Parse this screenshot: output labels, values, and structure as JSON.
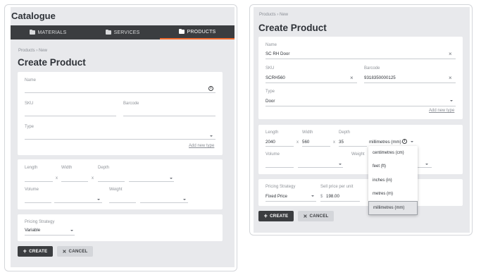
{
  "left": {
    "app_title": "Catalogue",
    "tabs": [
      {
        "label": "MATERIALS",
        "icon": "folder-icon"
      },
      {
        "label": "SERVICES",
        "icon": "folder-icon"
      },
      {
        "label": "PRODUCTS",
        "icon": "folder-icon",
        "active": true
      }
    ],
    "breadcrumb": "Products  ›  New",
    "title": "Create Product",
    "fields": {
      "name_label": "Name",
      "sku_label": "SKU",
      "barcode_label": "Barcode",
      "type_label": "Type",
      "add_type": "Add new type",
      "length_label": "Length",
      "width_label": "Width",
      "depth_label": "Depth",
      "volume_label": "Volume",
      "weight_label": "Weight",
      "pricing_label": "Pricing Strategy",
      "pricing_value": "Variable"
    },
    "buttons": {
      "create": "CREATE",
      "cancel": "CANCEL"
    }
  },
  "right": {
    "breadcrumb": "Products  ›  New",
    "title": "Create Product",
    "fields": {
      "name_label": "Name",
      "name_value": "SC RH Door",
      "sku_label": "SKU",
      "sku_value": "SCRH560",
      "barcode_label": "Barcode",
      "barcode_value": "9318350000125",
      "type_label": "Type",
      "type_value": "Door",
      "add_type": "Add new type",
      "length_label": "Length",
      "length_value": "2040",
      "width_label": "Width",
      "width_value": "560",
      "depth_label": "Depth",
      "depth_value": "35",
      "unit_value": "millimetres (mm)",
      "volume_label": "Volume",
      "weight_label": "Weight",
      "pricing_label": "Pricing Strategy",
      "pricing_value": "Fixed Price",
      "sell_label": "Sell price per unit",
      "currency": "$",
      "sell_value": "198.00"
    },
    "unit_options": [
      {
        "label": "centimetres (cm)"
      },
      {
        "label": "feet (ft)"
      },
      {
        "label": "inches (in)"
      },
      {
        "label": "metres (m)"
      },
      {
        "label": "millimetres (mm)",
        "selected": true
      }
    ],
    "buttons": {
      "create": "CREATE",
      "cancel": "CANCEL"
    }
  },
  "colors": {
    "accent": "#ef6b2f",
    "dark": "#3b3d40",
    "background": "#e8e9ec"
  }
}
